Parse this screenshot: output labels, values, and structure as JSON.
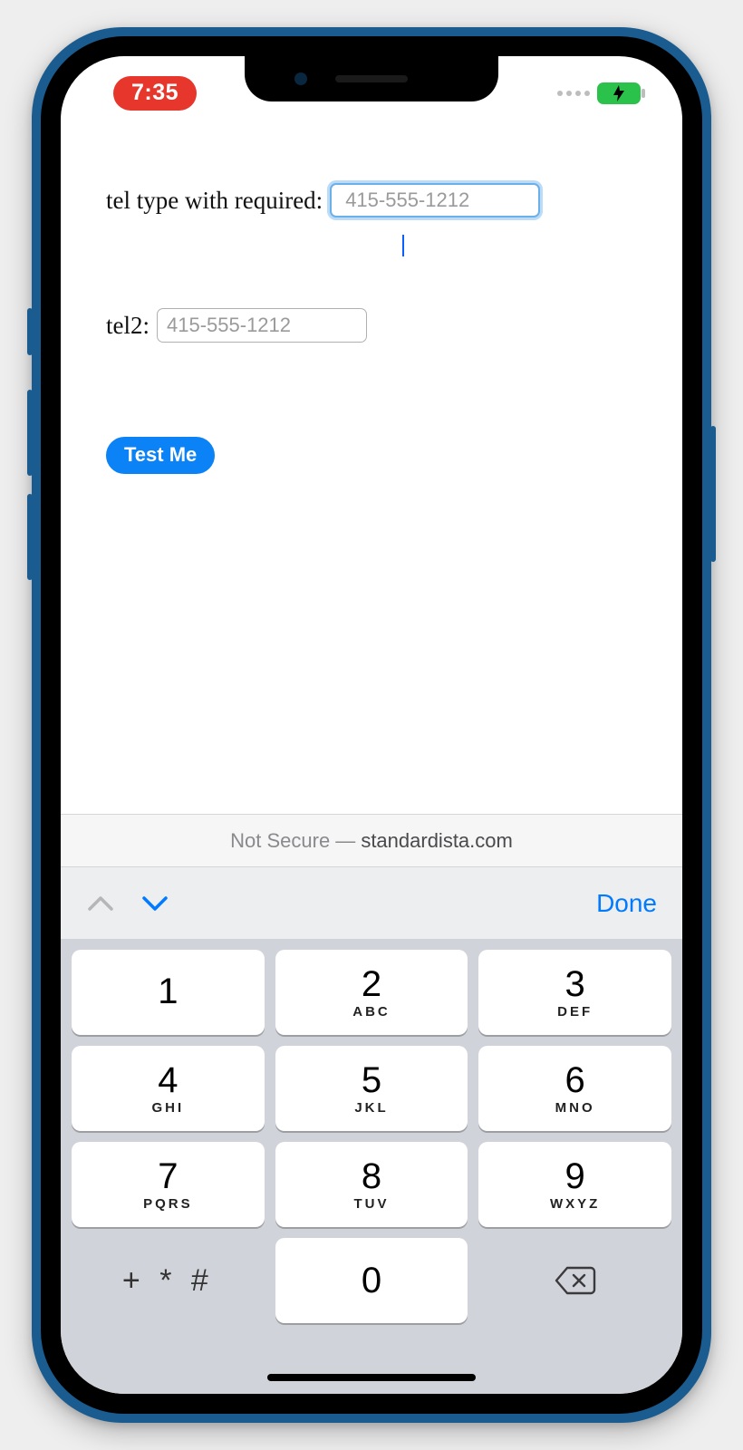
{
  "status": {
    "time": "7:35",
    "battery_icon": "battery-charging"
  },
  "form": {
    "field1": {
      "label": "tel type with required:",
      "placeholder": "415-555-1212",
      "value": ""
    },
    "field2": {
      "label": "tel2:",
      "placeholder": "415-555-1212",
      "value": ""
    },
    "submit_label": "Test Me"
  },
  "urlbar": {
    "prefix": "Not Secure —",
    "domain": "standardista.com"
  },
  "kb_accessory": {
    "done_label": "Done"
  },
  "keypad": {
    "rows": [
      [
        {
          "digit": "1",
          "letters": ""
        },
        {
          "digit": "2",
          "letters": "ABC"
        },
        {
          "digit": "3",
          "letters": "DEF"
        }
      ],
      [
        {
          "digit": "4",
          "letters": "GHI"
        },
        {
          "digit": "5",
          "letters": "JKL"
        },
        {
          "digit": "6",
          "letters": "MNO"
        }
      ],
      [
        {
          "digit": "7",
          "letters": "PQRS"
        },
        {
          "digit": "8",
          "letters": "TUV"
        },
        {
          "digit": "9",
          "letters": "WXYZ"
        }
      ]
    ],
    "sym": "+ * #",
    "zero": "0"
  }
}
